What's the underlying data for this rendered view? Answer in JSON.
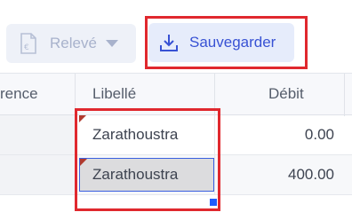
{
  "toolbar": {
    "releve_label": "Relevé",
    "save_label": "Sauvegarder"
  },
  "columns": {
    "prev_partial": "rence",
    "libelle": "Libellé",
    "debit": "Débit"
  },
  "rows": [
    {
      "libelle": "Zarathoustra",
      "debit": "0.00"
    },
    {
      "libelle": "Zarathoustra",
      "debit": "400.00"
    }
  ],
  "colors": {
    "accent": "#3852d4",
    "highlight": "#e0282e",
    "selection_border": "#3a5fe0"
  }
}
